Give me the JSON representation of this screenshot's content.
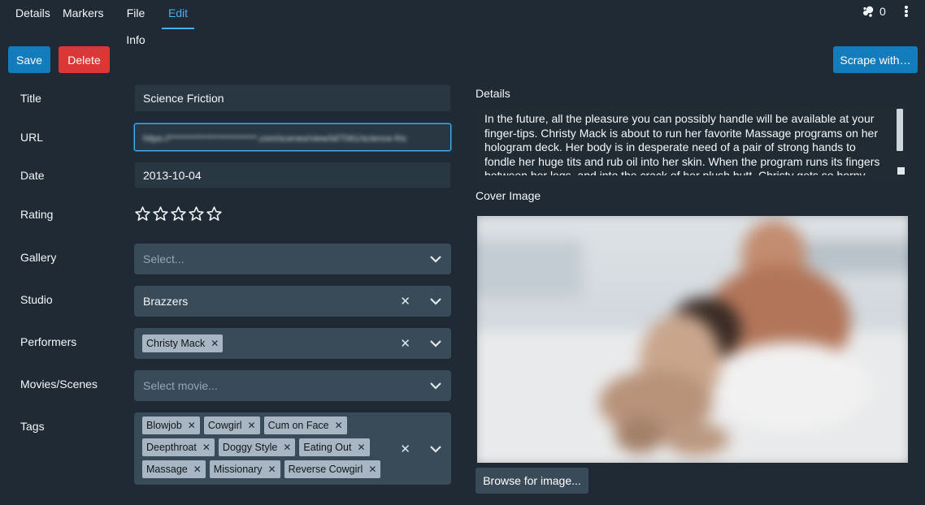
{
  "tabs": [
    {
      "label": "Details"
    },
    {
      "label": "Markers"
    },
    {
      "label": "File Info"
    },
    {
      "label": "Edit"
    }
  ],
  "o_counter": {
    "value": "0",
    "icon": "splash-icon"
  },
  "actions": {
    "save": "Save",
    "delete": "Delete",
    "scrape": "Scrape with…"
  },
  "fields": {
    "title": {
      "label": "Title",
      "value": "Science Friction"
    },
    "url": {
      "label": "URL",
      "value": "https://*************************.com/scenes/view/id/7061/science-fric"
    },
    "date": {
      "label": "Date",
      "value": "2013-10-04"
    },
    "rating": {
      "label": "Rating",
      "value": 0,
      "max": 5
    },
    "gallery": {
      "label": "Gallery",
      "placeholder": "Select..."
    },
    "studio": {
      "label": "Studio",
      "value": "Brazzers"
    },
    "performers": {
      "label": "Performers",
      "values": [
        "Christy Mack"
      ]
    },
    "movies": {
      "label": "Movies/Scenes",
      "placeholder": "Select movie..."
    },
    "tags": {
      "label": "Tags",
      "values": [
        "Blowjob",
        "Cowgirl",
        "Cum on Face",
        "Deepthroat",
        "Doggy Style",
        "Eating Out",
        "Massage",
        "Missionary",
        "Reverse Cowgirl"
      ]
    }
  },
  "details": {
    "label": "Details",
    "text": "In the future, all the pleasure you can possibly handle will be available at your finger-tips. Christy Mack is about to run her favorite Massage programs on her hologram deck. Her body is in desperate need of a pair of strong hands to fondle her huge tits and rub oil into her skin. When the program runs its fingers between her legs, and into the crack of her plush butt, Christy gets so horny she"
  },
  "cover": {
    "label": "Cover Image",
    "browse": "Browse for image..."
  },
  "colors": {
    "accent": "#48aff0",
    "primary": "#137cbd",
    "danger": "#db3737",
    "bg": "#1f2a35"
  }
}
